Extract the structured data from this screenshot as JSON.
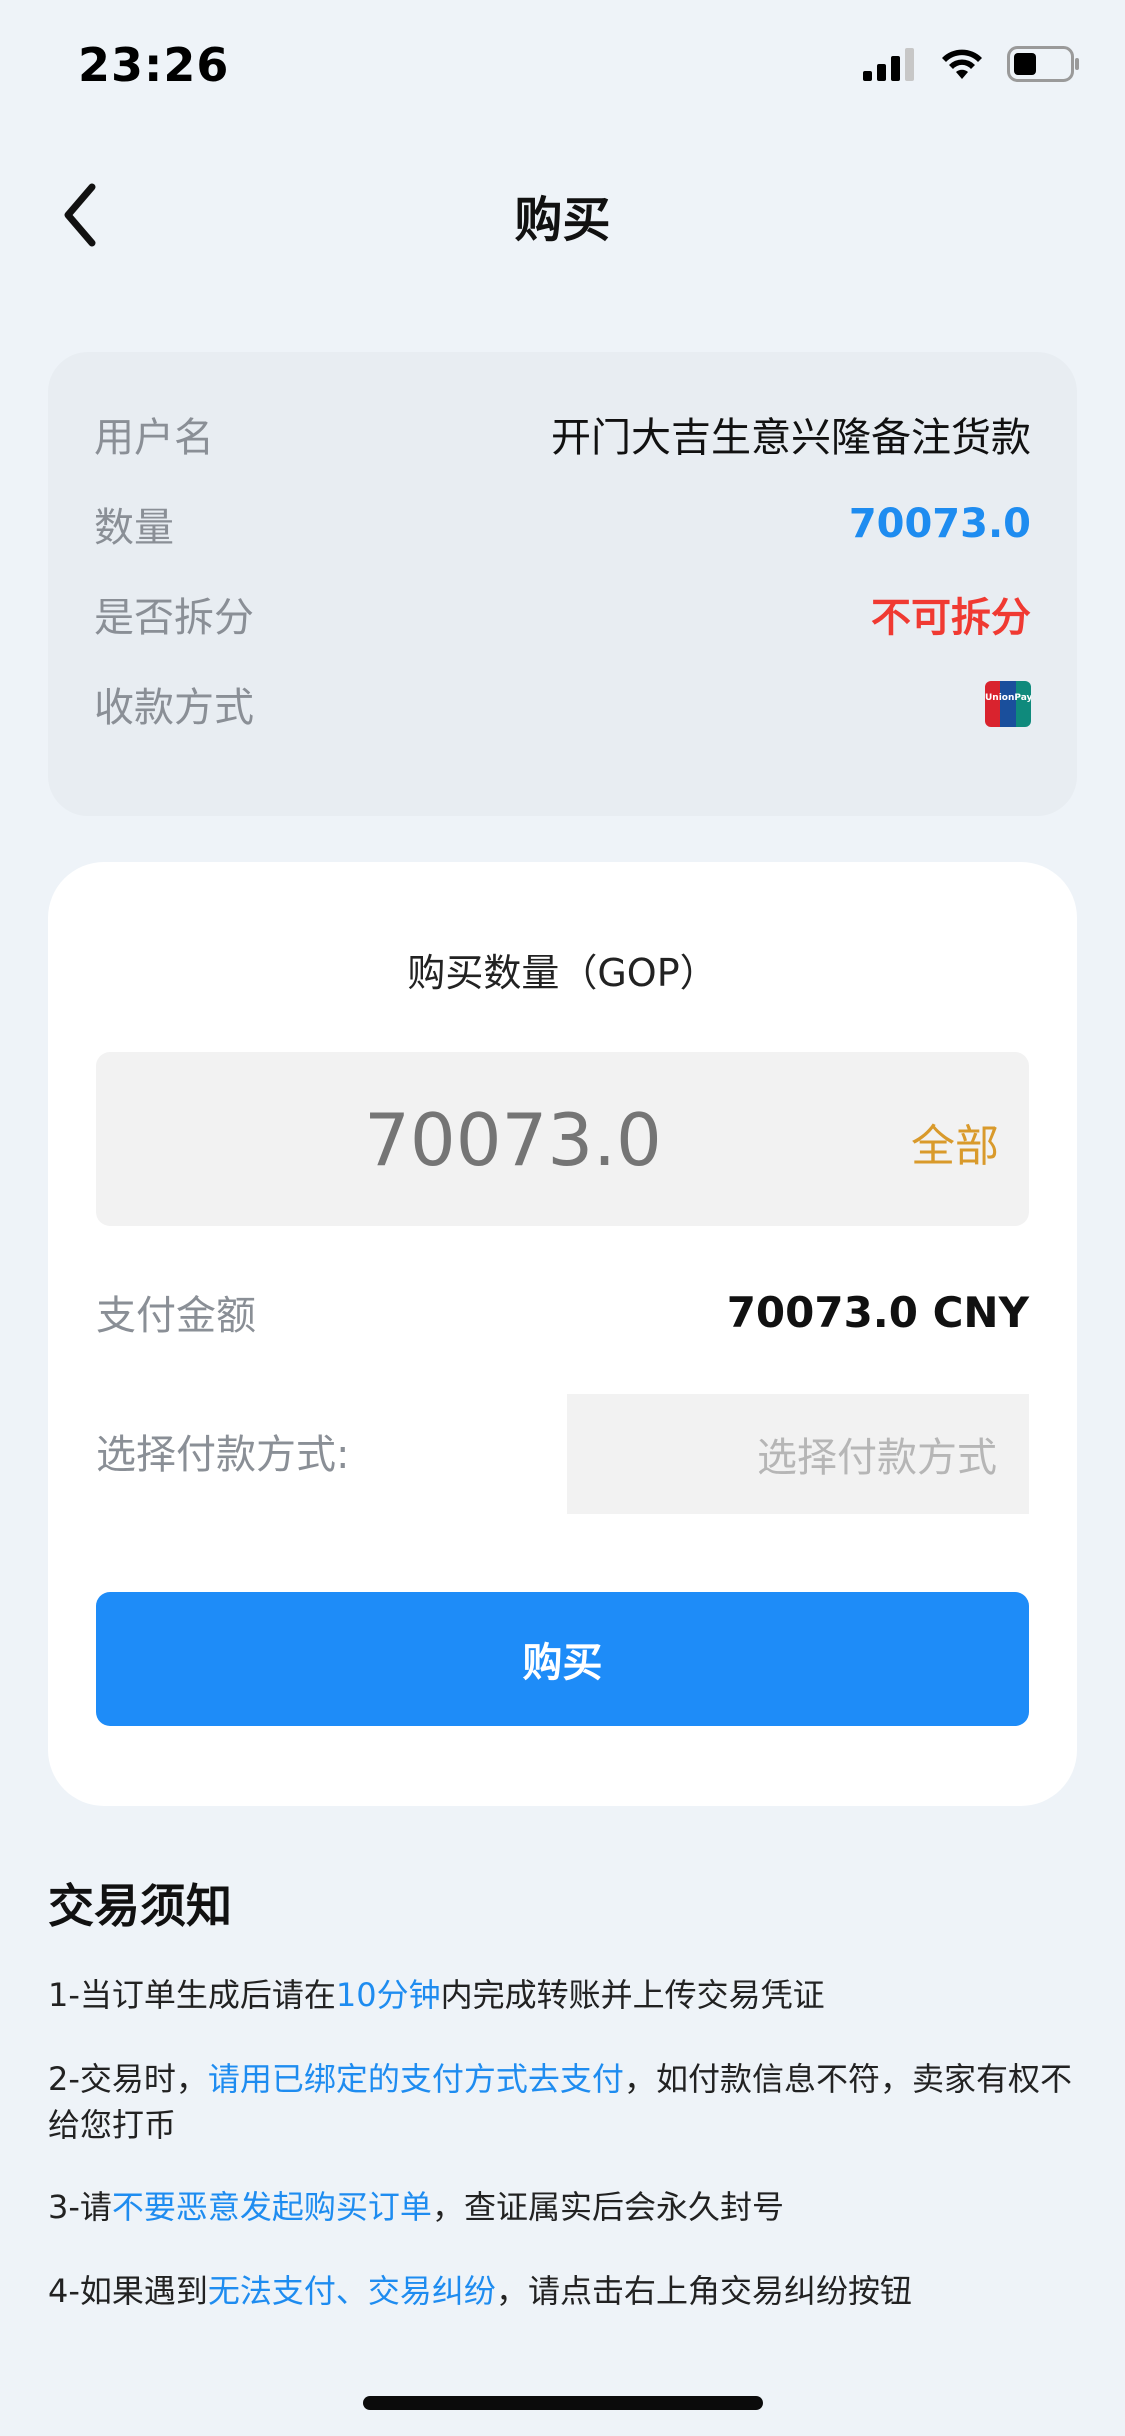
{
  "status_bar": {
    "time": "23:26"
  },
  "nav": {
    "title": "购买"
  },
  "info": {
    "username_label": "用户名",
    "username_value": "开门大吉生意兴隆备注货款",
    "quantity_label": "数量",
    "quantity_value": "70073.0",
    "split_label": "是否拆分",
    "split_value": "不可拆分",
    "payment_label": "收款方式",
    "payment_icon": "unionpay-icon",
    "unionpay_text": "UnionPay"
  },
  "buy": {
    "heading": "购买数量（GOP）",
    "amount_value": "70073.0",
    "all_label": "全部",
    "pay_label": "支付金额",
    "pay_value": "70073.0 CNY",
    "method_label": "选择付款方式:",
    "method_placeholder": "选择付款方式",
    "button_label": "购买"
  },
  "notice": {
    "title": "交易须知",
    "item1_a": "1-当订单生成后请在",
    "item1_hl": "10分钟",
    "item1_b": "内完成转账并上传交易凭证",
    "item2_a": "2-交易时，",
    "item2_hl": "请用已绑定的支付方式去支付",
    "item2_b": "，如付款信息不符，卖家有权不给您打币",
    "item3_a": "3-请",
    "item3_hl": "不要恶意发起购买订单",
    "item3_b": "，查证属实后会永久封号",
    "item4_a": "4-如果遇到",
    "item4_hl": "无法支付、交易纠纷",
    "item4_b": "，请点击右上角交易纠纷按钮"
  },
  "colors": {
    "accent_blue": "#1e8cf8",
    "warning_red": "#f03a32",
    "gold": "#d99a2b"
  }
}
